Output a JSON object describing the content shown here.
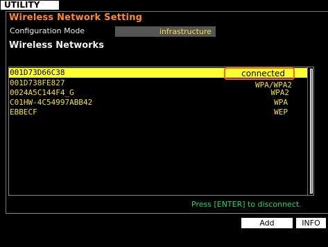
{
  "screen": {
    "tab_label": "UTILITY",
    "section_title": "Wireless Network Setting",
    "config_mode_label": "Configuration Mode",
    "config_mode_value": "infrastructure",
    "networks_title": "Wireless Networks"
  },
  "networks": [
    {
      "ssid": "001D73D66C38",
      "status": "connected",
      "selected": true
    },
    {
      "ssid": "001D738FE827",
      "status": "WPA/WPA2",
      "selected": false
    },
    {
      "ssid": "0024A5C144F4_G",
      "status": "WPA2",
      "selected": false
    },
    {
      "ssid": "C01HW-4C54997ABB42",
      "status": "WPA",
      "selected": false
    },
    {
      "ssid": "EBBECF",
      "status": "WEP",
      "selected": false
    }
  ],
  "hint": "Press [ENTER] to disconnect.",
  "buttons": {
    "add": "Add",
    "info": "INFO"
  },
  "colors": {
    "selection": "#ffff33",
    "ssid_text": "#f0e040",
    "section_title": "#ff8833",
    "hint_text": "#19d96b",
    "highlight_border": "#ff6600"
  }
}
